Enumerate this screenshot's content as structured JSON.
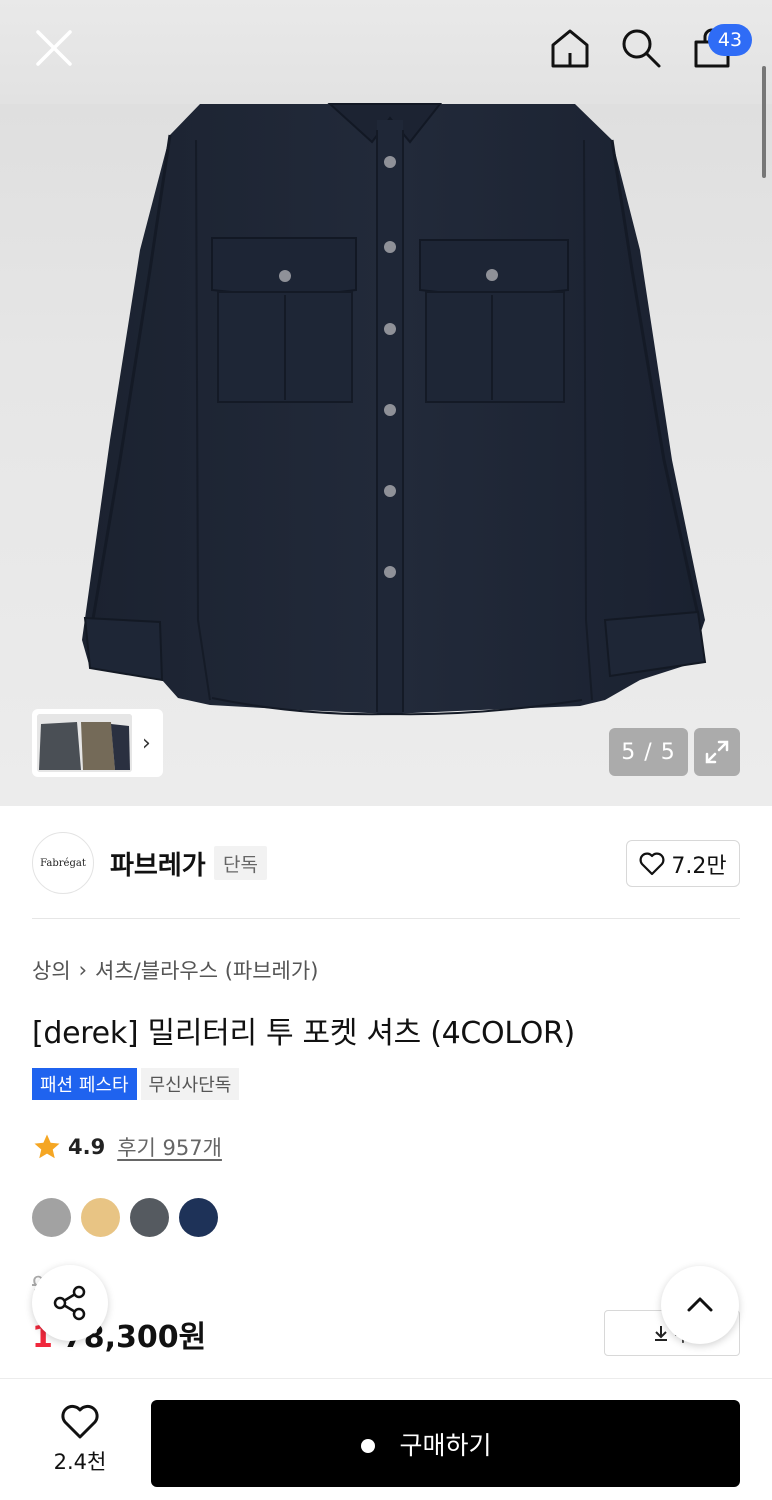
{
  "header": {
    "cart_count": "43",
    "icons": [
      "close-icon",
      "home-icon",
      "search-icon",
      "cart-icon"
    ]
  },
  "gallery": {
    "counter": "5 / 5",
    "current_image": 5,
    "total_images": 5,
    "thumbnail_arrow": "›"
  },
  "brand": {
    "logo_text": "Fabrégat",
    "name": "파브레가",
    "tag": "단독",
    "likes": "7.2만"
  },
  "product": {
    "breadcrumb": [
      "상의",
      "셔츠/블라우스 (파브레가)"
    ],
    "breadcrumb_separator": "›",
    "title": "[derek] 밀리터리 투 포켓 셔츠 (4COLOR)",
    "badges": {
      "primary": "패션 페스타",
      "secondary": "무신사단독"
    },
    "rating": {
      "score": "4.9",
      "reviews_label": "후기 957개"
    },
    "colors": [
      "#a2a2a2",
      "#e8c484",
      "#555a60",
      "#1e3258"
    ],
    "original_price": "9",
    "discount": "1",
    "price": "78,300원",
    "coupon_label": "쿠"
  },
  "bottom_bar": {
    "wishlist_count": "2.4천",
    "buy_label": "구매하기"
  },
  "theme": {
    "accent_blue": "#2f6cf6",
    "discount_red": "#f0283c"
  }
}
